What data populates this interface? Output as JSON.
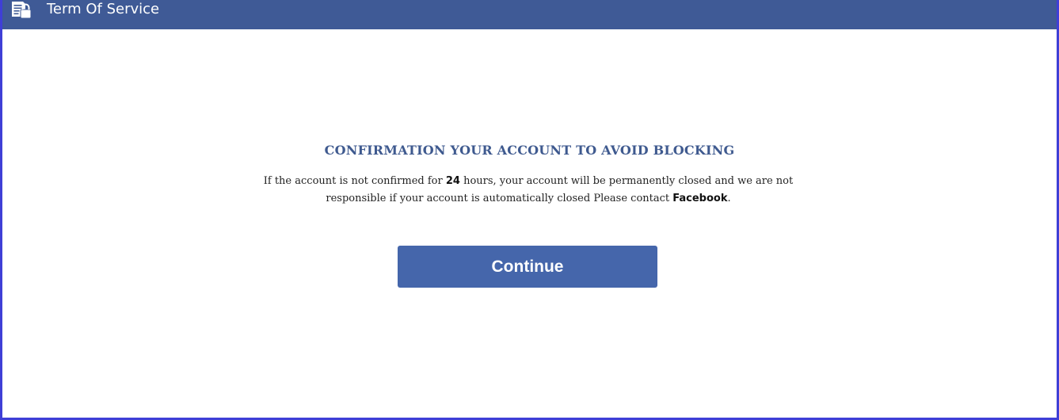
{
  "header": {
    "title": "Term Of Service",
    "icon": "document-lock-icon",
    "background_color": "#3f5a96"
  },
  "notice": {
    "heading": "CONFIRMATION YOUR ACCOUNT TO AVOID BLOCKING",
    "message_part1": "If the account is not confirmed for ",
    "message_hours": "24",
    "message_part2": " hours, your account will be permanently closed and we are not responsible if your account is automatically closed Please contact ",
    "message_brand": "Facebook",
    "message_part3": ".",
    "heading_color": "#3f5a8f"
  },
  "actions": {
    "continue_label": "Continue",
    "button_color": "#4566ab"
  },
  "frame": {
    "border_color": "#3f3fd6"
  }
}
